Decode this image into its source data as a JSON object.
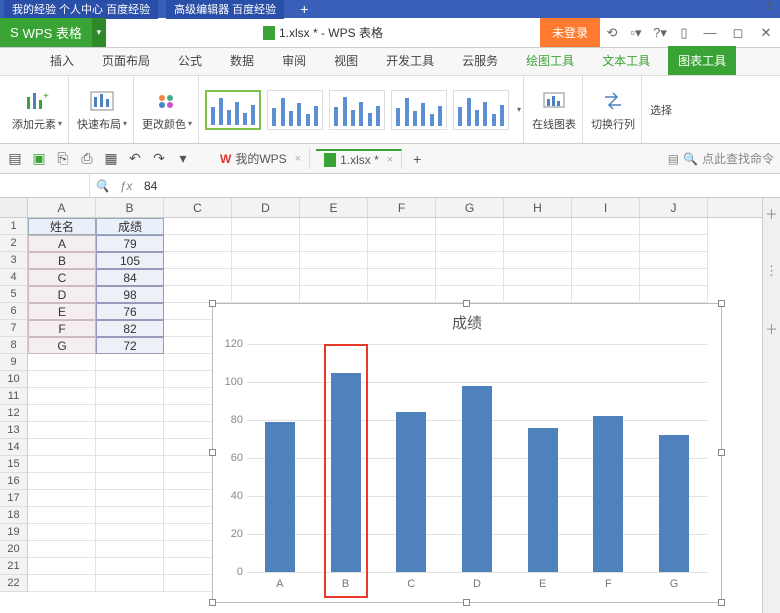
{
  "browser_tabs": [
    "我的经验 个人中心 百度经验",
    "高级编辑器 百度经验"
  ],
  "top_right_count": "2",
  "app_name": "WPS 表格",
  "doc_title": "1.xlsx * - WPS 表格",
  "login_label": "未登录",
  "ribbon_tabs": [
    "插入",
    "页面布局",
    "公式",
    "数据",
    "审阅",
    "视图",
    "开发工具",
    "云服务",
    "绘图工具",
    "文本工具",
    "图表工具"
  ],
  "ribbon_active_index": 10,
  "ribbon_groups": {
    "add_element": "添加元素",
    "quick_layout": "快速布局",
    "change_color": "更改颜色",
    "online_chart": "在线图表",
    "switch_rowcol": "切换行列",
    "select": "选择"
  },
  "file_tabs": [
    {
      "label": "我的WPS",
      "active": false
    },
    {
      "label": "1.xlsx *",
      "active": true
    }
  ],
  "search_placeholder": "点此查找命令",
  "formula_bar": {
    "name_box": "",
    "fx": "ƒx",
    "value": "84"
  },
  "columns": [
    "A",
    "B",
    "C",
    "D",
    "E",
    "F",
    "G",
    "H",
    "I",
    "J"
  ],
  "row_count": 22,
  "table_headers": {
    "name": "姓名",
    "score": "成绩"
  },
  "table_data": [
    {
      "name": "A",
      "score": "79"
    },
    {
      "name": "B",
      "score": "105"
    },
    {
      "name": "C",
      "score": "84"
    },
    {
      "name": "D",
      "score": "98"
    },
    {
      "name": "E",
      "score": "76"
    },
    {
      "name": "F",
      "score": "82"
    },
    {
      "name": "G",
      "score": "72"
    }
  ],
  "chart_data": {
    "type": "bar",
    "title": "成绩",
    "categories": [
      "A",
      "B",
      "C",
      "D",
      "E",
      "F",
      "G"
    ],
    "values": [
      79,
      105,
      84,
      98,
      76,
      82,
      72
    ],
    "ylim": [
      0,
      120
    ],
    "yticks": [
      0,
      20,
      40,
      60,
      80,
      100,
      120
    ],
    "highlighted_index": 1,
    "xlabel": "",
    "ylabel": ""
  }
}
